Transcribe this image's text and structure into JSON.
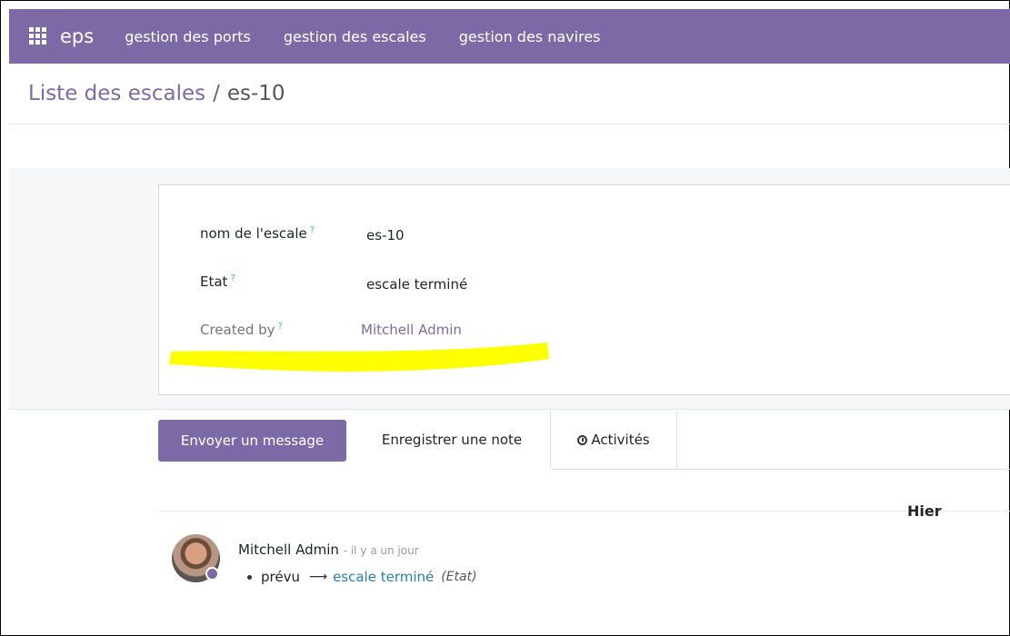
{
  "navbar": {
    "brand": "eps",
    "menu": [
      "gestion des ports",
      "gestion des escales",
      "gestion des navires"
    ]
  },
  "breadcrumb": {
    "parent": "Liste des escales",
    "separator": "/",
    "current": "es-10"
  },
  "form": {
    "fields": [
      {
        "label": "nom de l'escale",
        "help": "?",
        "value": "es-10"
      },
      {
        "label": "Etat",
        "help": "?",
        "value": "escale terminé"
      },
      {
        "label": "Created by",
        "help": "?",
        "value": "Mitchell Admin"
      }
    ]
  },
  "chatter": {
    "send_label": "Envoyer un message",
    "note_label": "Enregistrer une note",
    "activities_label": "Activités",
    "date_label": "Hier",
    "message": {
      "author": "Mitchell Admin",
      "time": "- il y a un jour",
      "old_value": "prévu",
      "new_value": "escale terminé",
      "field": "(Etat)"
    }
  },
  "colors": {
    "brand": "#7c6aa7",
    "highlight": "#ffff00",
    "link_value": "#2a7eb0"
  }
}
